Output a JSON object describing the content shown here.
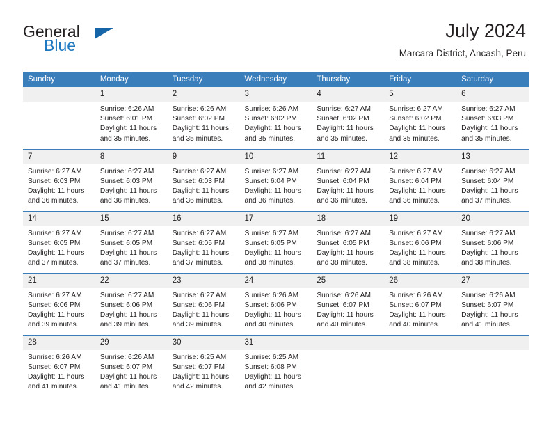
{
  "brand": {
    "name_part1": "General",
    "name_part2": "Blue",
    "triangle_icon": "triangle-icon"
  },
  "header": {
    "title": "July 2024",
    "subtitle": "Marcara District, Ancash, Peru"
  },
  "colors": {
    "header_blue": "#3b7ebc",
    "brand_blue": "#1f79c0",
    "daynum_band": "#f0f0f0",
    "text": "#231f20"
  },
  "weekday_headers": [
    "Sunday",
    "Monday",
    "Tuesday",
    "Wednesday",
    "Thursday",
    "Friday",
    "Saturday"
  ],
  "labels": {
    "sunrise_prefix": "Sunrise:",
    "sunset_prefix": "Sunset:",
    "daylight_prefix": "Daylight:"
  },
  "weeks": [
    [
      {
        "empty": true
      },
      {
        "day": "1",
        "sunrise": "Sunrise: 6:26 AM",
        "sunset": "Sunset: 6:01 PM",
        "daylight1": "Daylight: 11 hours",
        "daylight2": "and 35 minutes."
      },
      {
        "day": "2",
        "sunrise": "Sunrise: 6:26 AM",
        "sunset": "Sunset: 6:02 PM",
        "daylight1": "Daylight: 11 hours",
        "daylight2": "and 35 minutes."
      },
      {
        "day": "3",
        "sunrise": "Sunrise: 6:26 AM",
        "sunset": "Sunset: 6:02 PM",
        "daylight1": "Daylight: 11 hours",
        "daylight2": "and 35 minutes."
      },
      {
        "day": "4",
        "sunrise": "Sunrise: 6:27 AM",
        "sunset": "Sunset: 6:02 PM",
        "daylight1": "Daylight: 11 hours",
        "daylight2": "and 35 minutes."
      },
      {
        "day": "5",
        "sunrise": "Sunrise: 6:27 AM",
        "sunset": "Sunset: 6:02 PM",
        "daylight1": "Daylight: 11 hours",
        "daylight2": "and 35 minutes."
      },
      {
        "day": "6",
        "sunrise": "Sunrise: 6:27 AM",
        "sunset": "Sunset: 6:03 PM",
        "daylight1": "Daylight: 11 hours",
        "daylight2": "and 35 minutes."
      }
    ],
    [
      {
        "day": "7",
        "sunrise": "Sunrise: 6:27 AM",
        "sunset": "Sunset: 6:03 PM",
        "daylight1": "Daylight: 11 hours",
        "daylight2": "and 36 minutes."
      },
      {
        "day": "8",
        "sunrise": "Sunrise: 6:27 AM",
        "sunset": "Sunset: 6:03 PM",
        "daylight1": "Daylight: 11 hours",
        "daylight2": "and 36 minutes."
      },
      {
        "day": "9",
        "sunrise": "Sunrise: 6:27 AM",
        "sunset": "Sunset: 6:03 PM",
        "daylight1": "Daylight: 11 hours",
        "daylight2": "and 36 minutes."
      },
      {
        "day": "10",
        "sunrise": "Sunrise: 6:27 AM",
        "sunset": "Sunset: 6:04 PM",
        "daylight1": "Daylight: 11 hours",
        "daylight2": "and 36 minutes."
      },
      {
        "day": "11",
        "sunrise": "Sunrise: 6:27 AM",
        "sunset": "Sunset: 6:04 PM",
        "daylight1": "Daylight: 11 hours",
        "daylight2": "and 36 minutes."
      },
      {
        "day": "12",
        "sunrise": "Sunrise: 6:27 AM",
        "sunset": "Sunset: 6:04 PM",
        "daylight1": "Daylight: 11 hours",
        "daylight2": "and 36 minutes."
      },
      {
        "day": "13",
        "sunrise": "Sunrise: 6:27 AM",
        "sunset": "Sunset: 6:04 PM",
        "daylight1": "Daylight: 11 hours",
        "daylight2": "and 37 minutes."
      }
    ],
    [
      {
        "day": "14",
        "sunrise": "Sunrise: 6:27 AM",
        "sunset": "Sunset: 6:05 PM",
        "daylight1": "Daylight: 11 hours",
        "daylight2": "and 37 minutes."
      },
      {
        "day": "15",
        "sunrise": "Sunrise: 6:27 AM",
        "sunset": "Sunset: 6:05 PM",
        "daylight1": "Daylight: 11 hours",
        "daylight2": "and 37 minutes."
      },
      {
        "day": "16",
        "sunrise": "Sunrise: 6:27 AM",
        "sunset": "Sunset: 6:05 PM",
        "daylight1": "Daylight: 11 hours",
        "daylight2": "and 37 minutes."
      },
      {
        "day": "17",
        "sunrise": "Sunrise: 6:27 AM",
        "sunset": "Sunset: 6:05 PM",
        "daylight1": "Daylight: 11 hours",
        "daylight2": "and 38 minutes."
      },
      {
        "day": "18",
        "sunrise": "Sunrise: 6:27 AM",
        "sunset": "Sunset: 6:05 PM",
        "daylight1": "Daylight: 11 hours",
        "daylight2": "and 38 minutes."
      },
      {
        "day": "19",
        "sunrise": "Sunrise: 6:27 AM",
        "sunset": "Sunset: 6:06 PM",
        "daylight1": "Daylight: 11 hours",
        "daylight2": "and 38 minutes."
      },
      {
        "day": "20",
        "sunrise": "Sunrise: 6:27 AM",
        "sunset": "Sunset: 6:06 PM",
        "daylight1": "Daylight: 11 hours",
        "daylight2": "and 38 minutes."
      }
    ],
    [
      {
        "day": "21",
        "sunrise": "Sunrise: 6:27 AM",
        "sunset": "Sunset: 6:06 PM",
        "daylight1": "Daylight: 11 hours",
        "daylight2": "and 39 minutes."
      },
      {
        "day": "22",
        "sunrise": "Sunrise: 6:27 AM",
        "sunset": "Sunset: 6:06 PM",
        "daylight1": "Daylight: 11 hours",
        "daylight2": "and 39 minutes."
      },
      {
        "day": "23",
        "sunrise": "Sunrise: 6:27 AM",
        "sunset": "Sunset: 6:06 PM",
        "daylight1": "Daylight: 11 hours",
        "daylight2": "and 39 minutes."
      },
      {
        "day": "24",
        "sunrise": "Sunrise: 6:26 AM",
        "sunset": "Sunset: 6:06 PM",
        "daylight1": "Daylight: 11 hours",
        "daylight2": "and 40 minutes."
      },
      {
        "day": "25",
        "sunrise": "Sunrise: 6:26 AM",
        "sunset": "Sunset: 6:07 PM",
        "daylight1": "Daylight: 11 hours",
        "daylight2": "and 40 minutes."
      },
      {
        "day": "26",
        "sunrise": "Sunrise: 6:26 AM",
        "sunset": "Sunset: 6:07 PM",
        "daylight1": "Daylight: 11 hours",
        "daylight2": "and 40 minutes."
      },
      {
        "day": "27",
        "sunrise": "Sunrise: 6:26 AM",
        "sunset": "Sunset: 6:07 PM",
        "daylight1": "Daylight: 11 hours",
        "daylight2": "and 41 minutes."
      }
    ],
    [
      {
        "day": "28",
        "sunrise": "Sunrise: 6:26 AM",
        "sunset": "Sunset: 6:07 PM",
        "daylight1": "Daylight: 11 hours",
        "daylight2": "and 41 minutes."
      },
      {
        "day": "29",
        "sunrise": "Sunrise: 6:26 AM",
        "sunset": "Sunset: 6:07 PM",
        "daylight1": "Daylight: 11 hours",
        "daylight2": "and 41 minutes."
      },
      {
        "day": "30",
        "sunrise": "Sunrise: 6:25 AM",
        "sunset": "Sunset: 6:07 PM",
        "daylight1": "Daylight: 11 hours",
        "daylight2": "and 42 minutes."
      },
      {
        "day": "31",
        "sunrise": "Sunrise: 6:25 AM",
        "sunset": "Sunset: 6:08 PM",
        "daylight1": "Daylight: 11 hours",
        "daylight2": "and 42 minutes."
      },
      {
        "empty": true
      },
      {
        "empty": true
      },
      {
        "empty": true
      }
    ]
  ]
}
